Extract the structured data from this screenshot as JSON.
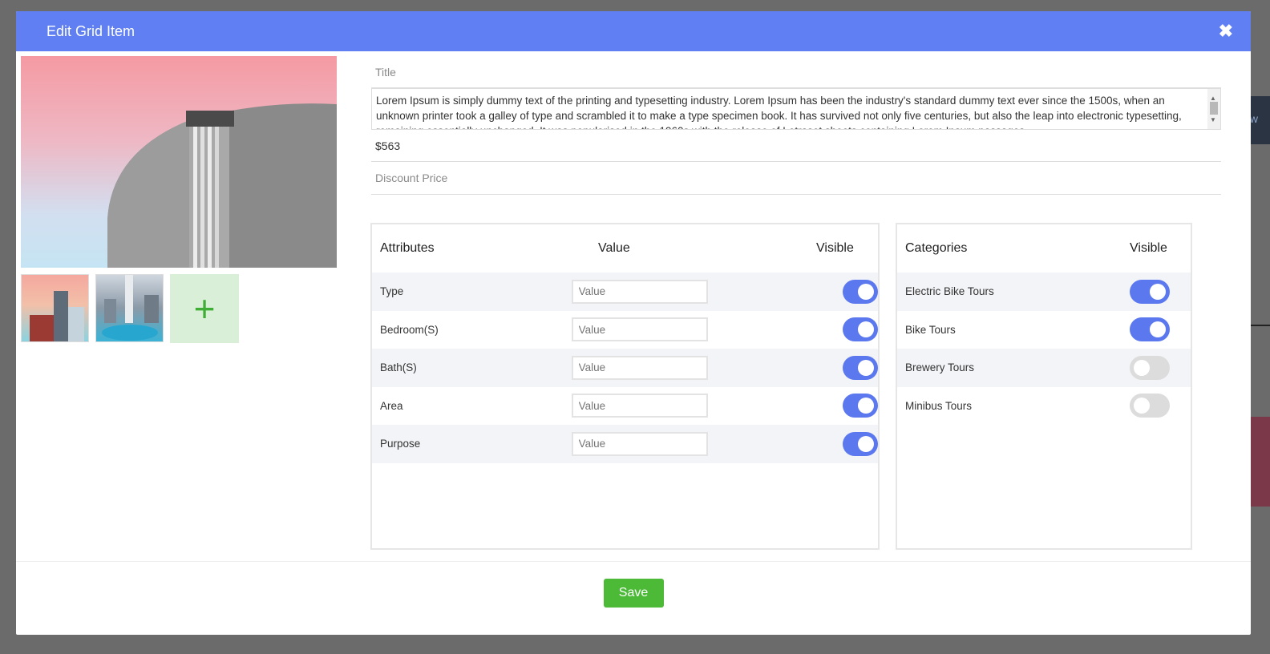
{
  "modal": {
    "title": "Edit Grid Item",
    "close_icon": "close-icon"
  },
  "background": {
    "peek_text": "iew"
  },
  "images": {
    "main": "building-photo",
    "thumbnails": [
      "building-thumb",
      "city-aerial-thumb"
    ],
    "add_label": "+"
  },
  "form": {
    "title_placeholder": "Title",
    "description": "Lorem Ipsum is simply dummy text of the printing and typesetting industry. Lorem Ipsum has been the industry's standard dummy text ever since the 1500s, when an unknown printer took a galley of type and scrambled it to make a type specimen book. It has survived not only five centuries, but also the leap into electronic typesetting, remaining essentially unchanged. It was popularised in the 1960s with the release of Letraset sheets containing Lorem Ipsum passages",
    "price": "$563",
    "discount_placeholder": "Discount Price"
  },
  "attributes": {
    "headers": {
      "name": "Attributes",
      "value": "Value",
      "visible": "Visible"
    },
    "value_placeholder": "Value",
    "rows": [
      {
        "name": "Type",
        "visible": true
      },
      {
        "name": "Bedroom(S)",
        "visible": true
      },
      {
        "name": "Bath(S)",
        "visible": true
      },
      {
        "name": "Area",
        "visible": true
      },
      {
        "name": "Purpose",
        "visible": true
      }
    ]
  },
  "categories": {
    "headers": {
      "name": "Categories",
      "visible": "Visible"
    },
    "rows": [
      {
        "name": "Electric Bike Tours",
        "visible": true
      },
      {
        "name": "Bike Tours",
        "visible": true
      },
      {
        "name": "Brewery Tours",
        "visible": false
      },
      {
        "name": "Minibus Tours",
        "visible": false
      }
    ]
  },
  "footer": {
    "save_label": "Save"
  },
  "colors": {
    "header": "#5f7ff3",
    "toggle_on": "#5b78ef",
    "save": "#4cba37"
  }
}
